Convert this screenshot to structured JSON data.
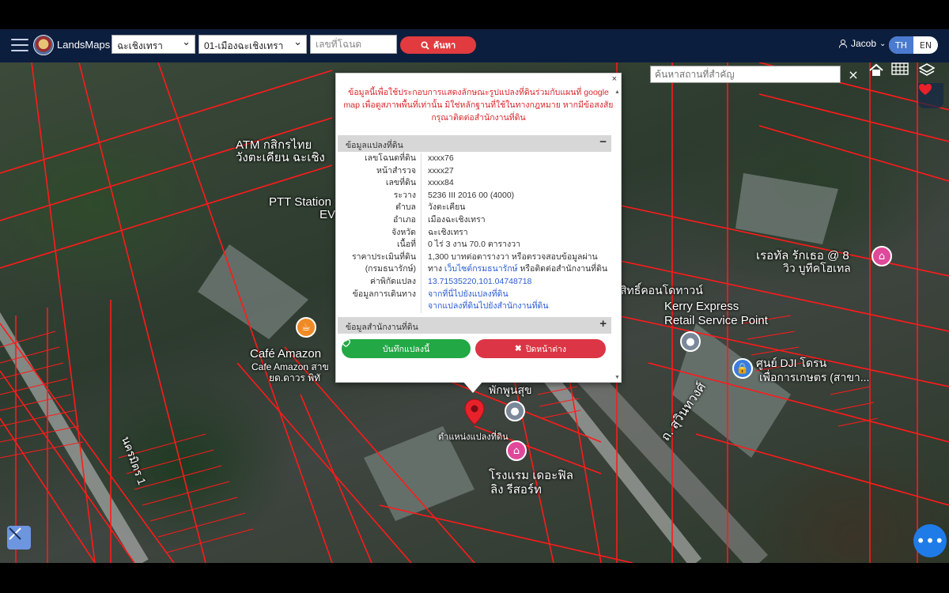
{
  "header": {
    "brand": "LandsMaps",
    "province": "ฉะเชิงเทรา",
    "district": "01-เมืองฉะเชิงเทรา",
    "deed_placeholder": "เลขที่โฉนด",
    "search_label": "ค้นหา",
    "user_name": "Jacob",
    "lang_th": "TH",
    "lang_en": "EN"
  },
  "map": {
    "place_search_placeholder": "ค้นหาสถานที่สำคัญ",
    "clear_symbol": "×",
    "labels": {
      "atm": "ATM กสิกรไทย",
      "atm2": "วังตะเคียน ฉะเชิง",
      "ptt": "PTT Station",
      "ptt2": "EV",
      "cafe": "Café Amazon",
      "cafe2": "Cafe Amazon สาข",
      "cafe3": "ยด.ดาวร พิทั",
      "kerry": "Kerry Express",
      "kerry2": "Retail Service Point",
      "condo": "สิทธิ์คอนโดทาวน์",
      "hotel": "เรอทัล รักเธอ @ 8",
      "hotel2": "วิว บูทีคโฮเทล",
      "dji": "ศูนย์ DJI โดรน",
      "dji2": "เพื่อการเกษตร (สาขา...",
      "road": "ถ. สุวินทวงศ์",
      "soi": "นครมิตร 1",
      "parcel_pos": "ตำแหน่งแปลงที่ดิน",
      "resort": "โรงแรม เดอะฟิล",
      "resort2": "ลิง รีสอร์ท",
      "phunsuk": "พักพูนสุข"
    },
    "more_symbol": "•••"
  },
  "popup": {
    "close_symbol": "×",
    "disclaimer": "ข้อมูลนี้เพื่อใช้ประกอบการแสดงลักษณะรูปแปลงที่ดินร่วมกับแผนที่ google map เพื่อดูสภาพพื้นที่เท่านั้น มิใช่หลักฐานที่ใช้ในทางกฎหมาย หากมีข้อสงสัย กรุณาติดต่อสำนักงานที่ดิน",
    "parcel_section": "ข้อมูลแปลงที่ดิน",
    "parcel_toggle": "−",
    "office_section": "ข้อมูลสำนักงานที่ดิน",
    "office_toggle": "+",
    "rows": [
      {
        "k": "เลขโฉนดที่ดิน",
        "v": "xxxx76"
      },
      {
        "k": "หน้าสำรวจ",
        "v": "xxxx27"
      },
      {
        "k": "เลขที่ดิน",
        "v": "xxxx84"
      },
      {
        "k": "ระวาง",
        "v": "5236 III 2016 00 (4000)"
      },
      {
        "k": "ตำบล",
        "v": "วังตะเคียน"
      },
      {
        "k": "อำเภอ",
        "v": "เมืองฉะเชิงเทรา"
      },
      {
        "k": "จังหวัด",
        "v": "ฉะเชิงเทรา"
      },
      {
        "k": "เนื้อที่",
        "v": "0 ไร่ 3 งาน 70.0 ตารางวา"
      }
    ],
    "price_k1": "ราคาประเมินที่ดิน",
    "price_k2": "(กรมธนารักษ์)",
    "price_v1": "1,300 บาทต่อตารางวา หรือตรวจสอบข้อมูลผ่าน",
    "price_v2a": "ทาง",
    "price_v2_link": "เว็บไซต์กรมธนารักษ์",
    "price_v2b": "หรือติดต่อสำนักงานที่ดิน",
    "coord_k": "ค่าพิกัดแปลง",
    "coord_v": "13.71535220,101.04748718",
    "travel_k": "ข้อมูลการเดินทาง",
    "travel_v1": "จากที่นี่ไปยังแปลงที่ดิน",
    "travel_v2": "จากแปลงที่ดินไปยังสำนักงานที่ดิน",
    "save_label": "บันทึกแปลงนี้",
    "close_label": "ปิดหน้าต่าง"
  },
  "colors": {
    "parcel_line": "#ff1a1a",
    "save": "#22a845",
    "close": "#dc3545",
    "nav": "#0c1e3e"
  }
}
